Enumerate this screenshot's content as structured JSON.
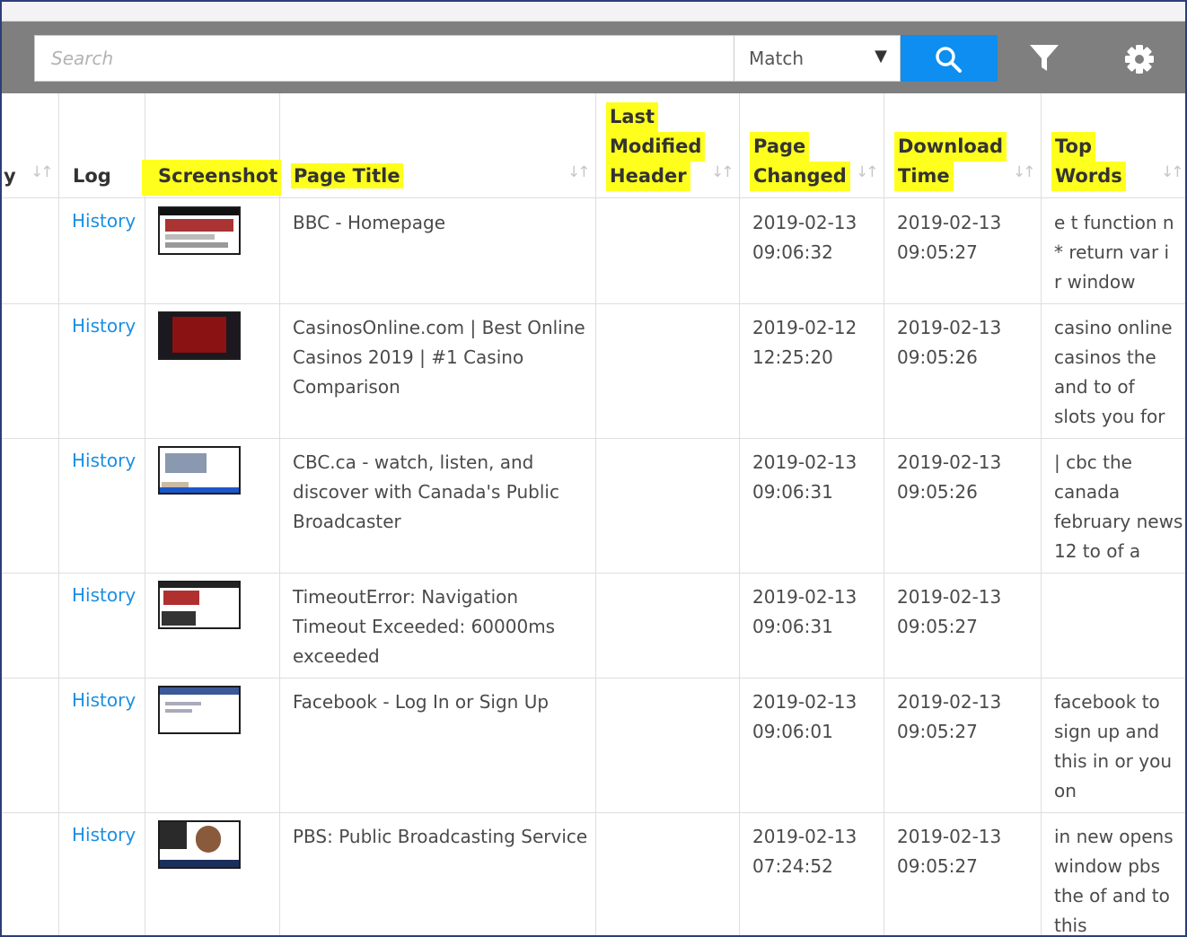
{
  "search": {
    "placeholder": "Search",
    "match_label": "Match",
    "caret": "▼"
  },
  "icons": {
    "search": "search-icon",
    "filter": "filter-icon",
    "settings": "gear-icon"
  },
  "colors": {
    "accent": "#0d8ef0",
    "link": "#1a8fe3",
    "highlight": "#ffff1e",
    "toolbar": "#7f7f7f"
  },
  "table": {
    "headers": {
      "partial": "y",
      "log": "Log",
      "screenshot": "Screenshot",
      "page_title": "Page Title",
      "last_modified": [
        "Last",
        "Modified",
        "Header"
      ],
      "page_changed": [
        "Page",
        "Changed"
      ],
      "download_time": [
        "Download",
        "Time"
      ],
      "top_words": [
        "Top",
        "Words"
      ],
      "sort_glyph": "↓↑"
    },
    "rows": [
      {
        "log": "History",
        "title": [
          "BBC - Homepage"
        ],
        "changed": [
          "2019-02-13",
          "09:06:32"
        ],
        "download": [
          "2019-02-13",
          "09:05:27"
        ],
        "words": [
          "e t function n",
          "* return var i",
          "r window"
        ]
      },
      {
        "log": "History",
        "title": [
          "CasinosOnline.com | Best Online",
          "Casinos 2019 | #1 Casino",
          "Comparison"
        ],
        "changed": [
          "2019-02-12",
          "12:25:20"
        ],
        "download": [
          "2019-02-13",
          "09:05:26"
        ],
        "words": [
          "casino online",
          "casinos the",
          "and to of",
          "slots you for"
        ]
      },
      {
        "log": "History",
        "title": [
          "CBC.ca - watch, listen, and",
          "discover with Canada's Public",
          "Broadcaster"
        ],
        "changed": [
          "2019-02-13",
          "09:06:31"
        ],
        "download": [
          "2019-02-13",
          "09:05:26"
        ],
        "words": [
          "| cbc the",
          "canada",
          "february news",
          "12 to of a"
        ]
      },
      {
        "log": "History",
        "title": [
          "TimeoutError: Navigation",
          "Timeout Exceeded: 60000ms",
          "exceeded"
        ],
        "changed": [
          "2019-02-13",
          "09:06:31"
        ],
        "download": [
          "2019-02-13",
          "09:05:27"
        ],
        "words": []
      },
      {
        "log": "History",
        "title": [
          "Facebook - Log In or Sign Up"
        ],
        "changed": [
          "2019-02-13",
          "09:06:01"
        ],
        "download": [
          "2019-02-13",
          "09:05:27"
        ],
        "words": [
          "facebook to",
          "sign up and",
          "this in or you",
          "on"
        ]
      },
      {
        "log": "History",
        "title": [
          "PBS: Public Broadcasting Service"
        ],
        "changed": [
          "2019-02-13",
          "07:24:52"
        ],
        "download": [
          "2019-02-13",
          "09:05:27"
        ],
        "words": [
          "in new opens",
          "window pbs",
          "the of and to",
          "this"
        ]
      }
    ]
  }
}
